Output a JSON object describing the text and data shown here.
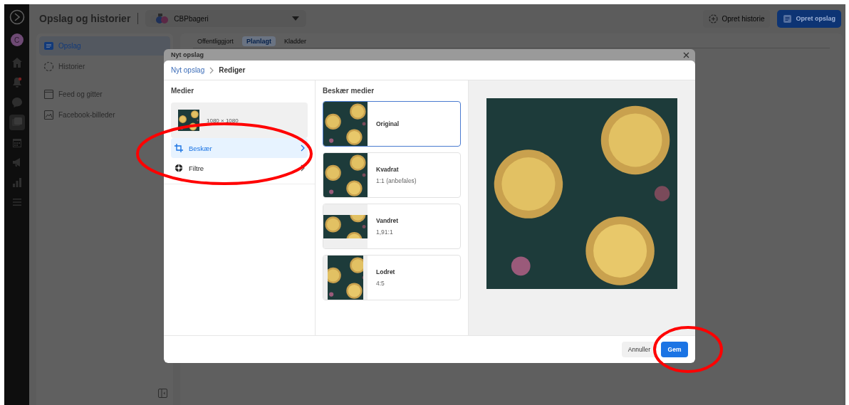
{
  "rail": {
    "avatar": "C",
    "items": [
      {
        "kind": "home",
        "selected": false
      },
      {
        "kind": "bell",
        "selected": false
      },
      {
        "kind": "chat",
        "selected": false
      },
      {
        "kind": "posts",
        "selected": true
      },
      {
        "kind": "calendar",
        "selected": false
      },
      {
        "kind": "megaphone",
        "selected": false
      },
      {
        "kind": "chart",
        "selected": false
      },
      {
        "kind": "menu",
        "selected": false
      }
    ]
  },
  "header": {
    "title": "Opslag og historier",
    "page_selector": "CBPbageri",
    "buttons": [
      {
        "label": "Opret historie",
        "kind": "secondary"
      },
      {
        "label": "Opret opslag",
        "kind": "primary"
      }
    ]
  },
  "nav": [
    {
      "label": "Opslag",
      "kind": "posts",
      "selected": true
    },
    {
      "label": "Historier",
      "kind": "stories",
      "selected": false
    },
    {
      "label": "Feed og gitter",
      "kind": "feed",
      "selected": false
    },
    {
      "label": "Facebook-billeder",
      "kind": "photos",
      "selected": false
    }
  ],
  "tabs": [
    {
      "label": "Offentliggjort",
      "selected": false
    },
    {
      "label": "Planlagt",
      "selected": true
    },
    {
      "label": "Kladder",
      "selected": false
    }
  ],
  "dialog": {
    "title": "Nyt opslag",
    "breadcrumb": [
      {
        "label": "Nyt opslag",
        "kind": "link"
      },
      {
        "label": "Rediger",
        "kind": "current"
      }
    ],
    "media": {
      "heading": "Medier",
      "size": "1080 × 1080"
    },
    "tools": [
      {
        "label": "Beskær",
        "kind": "crop",
        "selected": true
      },
      {
        "label": "Filtre",
        "kind": "filter",
        "selected": false
      }
    ],
    "crop": {
      "heading": "Beskær medier",
      "options": [
        {
          "title": "Original",
          "kind": "original",
          "selected": true
        },
        {
          "title": "Kvadrat",
          "ratio": "1:1 (anbefales)",
          "kind": "square",
          "selected": false
        },
        {
          "title": "Vandret",
          "ratio": "1,91:1",
          "kind": "landscape",
          "selected": false
        },
        {
          "title": "Lodret",
          "ratio": "4:5",
          "kind": "portrait",
          "selected": false
        }
      ]
    },
    "buttons": [
      {
        "label": "Annuller",
        "kind": "secondary"
      },
      {
        "label": "Gem",
        "kind": "primary"
      }
    ]
  }
}
